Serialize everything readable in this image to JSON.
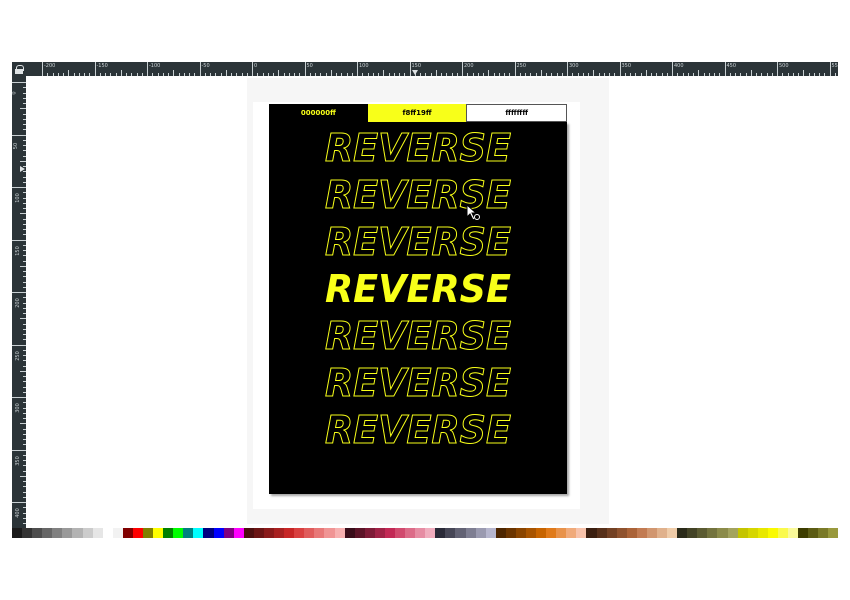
{
  "ruler": {
    "labels": [
      "-200",
      "-150",
      "-100",
      "-50",
      "0",
      "50",
      "100",
      "150",
      "200",
      "250",
      "300",
      "350",
      "400",
      "450",
      "500",
      "550"
    ],
    "side_labels": [
      "0",
      "50",
      "100",
      "150",
      "200",
      "250",
      "300",
      "350",
      "400",
      "450",
      "500",
      "550",
      "600",
      "650",
      "700"
    ]
  },
  "swatches": [
    {
      "label": "000000ff",
      "color": "#000000"
    },
    {
      "label": "f8ff19ff",
      "color": "#f8ff19"
    },
    {
      "label": "ffffffff",
      "color": "#ffffff"
    }
  ],
  "poster": {
    "background": "#000000",
    "accent": "#f8ff19",
    "words": [
      {
        "text": "REVERSE",
        "style": "outline"
      },
      {
        "text": "REVERSE",
        "style": "outline"
      },
      {
        "text": "REVERSE",
        "style": "outline"
      },
      {
        "text": "REVERSE",
        "style": "filled"
      },
      {
        "text": "REVERSE",
        "style": "outline"
      },
      {
        "text": "REVERSE",
        "style": "outline"
      },
      {
        "text": "REVERSE",
        "style": "outline"
      }
    ]
  },
  "cursor": {
    "icon": "pointer-cursor-icon"
  },
  "palette": {
    "colors": [
      "#1a1a1a",
      "#333333",
      "#4d4d4d",
      "#666666",
      "#808080",
      "#999999",
      "#b3b3b3",
      "#cccccc",
      "#e6e6e6",
      "#ffffff",
      "#f2f2f2",
      "#800000",
      "#ff0000",
      "#808000",
      "#ffff00",
      "#008000",
      "#00ff00",
      "#008080",
      "#00ffff",
      "#000080",
      "#0000ff",
      "#800080",
      "#ff00ff",
      "#4d0f0f",
      "#6b1414",
      "#8a1a1a",
      "#a82020",
      "#c72626",
      "#d94040",
      "#e05c5c",
      "#e87878",
      "#f09494",
      "#f7b0b0",
      "#3a0d1a",
      "#5c1428",
      "#7e1b37",
      "#a02246",
      "#c22955",
      "#d14a6e",
      "#dc6b88",
      "#e68ca3",
      "#f0adbe",
      "#2a2a38",
      "#464656",
      "#626274",
      "#7e7e92",
      "#9a9ab0",
      "#b6b6ce",
      "#4d2600",
      "#6b3500",
      "#8a4500",
      "#a85400",
      "#c76400",
      "#e07a1a",
      "#e8924a",
      "#f0aa7a",
      "#f7c2aa",
      "#3b1f10",
      "#57301a",
      "#734124",
      "#8f522e",
      "#ab6338",
      "#c27b52",
      "#d1966f",
      "#e0b18c",
      "#efcca9",
      "#2b2b1a",
      "#434326",
      "#5b5b32",
      "#73733e",
      "#8b8b4a",
      "#a3a35e",
      "#c4c400",
      "#d6d600",
      "#e8e800",
      "#fafa00",
      "#fafa4d",
      "#fafa99",
      "#3d3d00",
      "#5c5c14",
      "#7a7a28",
      "#99993d"
    ]
  }
}
